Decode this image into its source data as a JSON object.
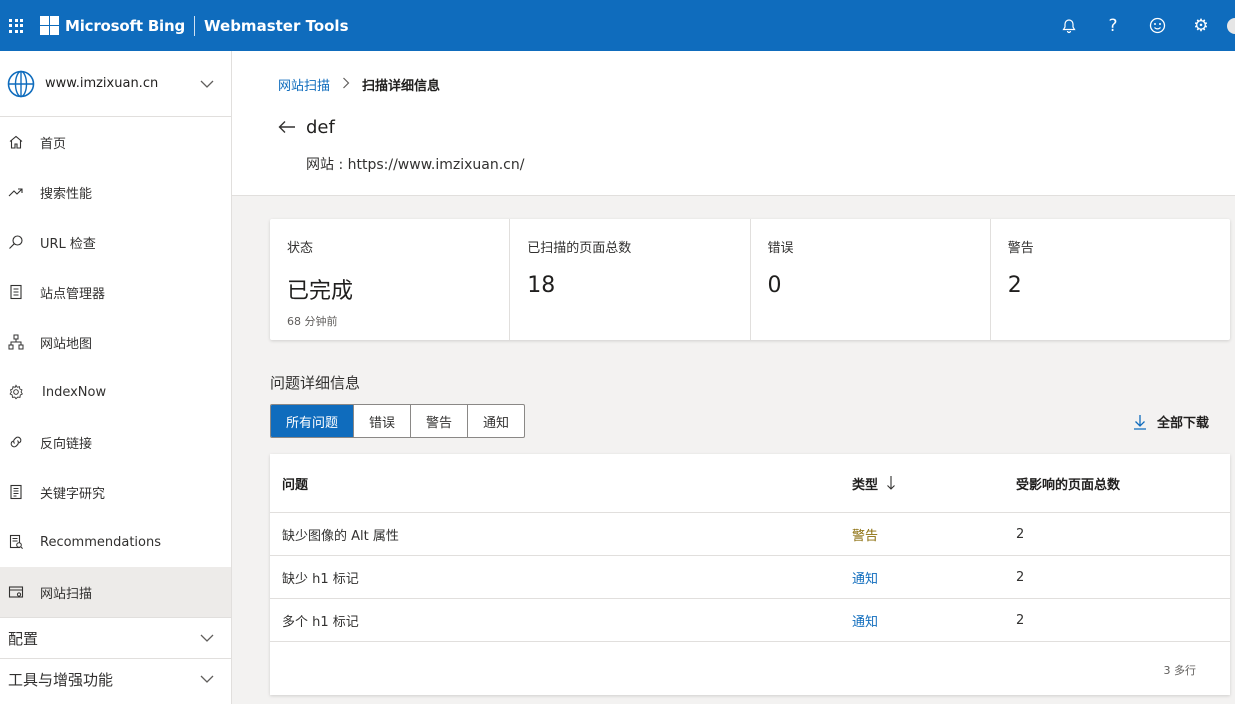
{
  "header": {
    "brand": "Microsoft Bing",
    "product": "Webmaster Tools",
    "icons": [
      "bell-icon",
      "help-icon",
      "feedback-smiley-icon",
      "settings-gear-icon"
    ],
    "accent_color": "#0f6cbd"
  },
  "sidebar": {
    "site": "www.imzixuan.cn",
    "items": [
      {
        "label": "首页",
        "icon": "home-icon"
      },
      {
        "label": "搜索性能",
        "icon": "trend-icon"
      },
      {
        "label": "URL 检查",
        "icon": "search-icon"
      },
      {
        "label": "站点管理器",
        "icon": "clipboard-icon"
      },
      {
        "label": "网站地图",
        "icon": "sitemap-icon"
      },
      {
        "label": "IndexNow",
        "icon": "gear-icon"
      },
      {
        "label": "反向链接",
        "icon": "link-icon"
      },
      {
        "label": "关键字研究",
        "icon": "document-icon"
      },
      {
        "label": "Recommendations",
        "icon": "recommendations-icon"
      },
      {
        "label": "网站扫描",
        "icon": "scan-icon",
        "active": true
      }
    ],
    "groups": [
      {
        "label": "配置"
      },
      {
        "label": "工具与增强功能"
      }
    ]
  },
  "breadcrumb": {
    "parent": "网站扫描",
    "current": "扫描详细信息"
  },
  "scan": {
    "name": "def",
    "site_line": "网站 : https://www.imzixuan.cn/"
  },
  "stats": [
    {
      "label": "状态",
      "value": "已完成",
      "sub": "68 分钟前"
    },
    {
      "label": "已扫描的页面总数",
      "value": "18"
    },
    {
      "label": "错误",
      "value": "0"
    },
    {
      "label": "警告",
      "value": "2"
    }
  ],
  "issues": {
    "title": "问题详细信息",
    "filters": [
      "所有问题",
      "错误",
      "警告",
      "通知"
    ],
    "active_filter": "所有问题",
    "download_label": "全部下载",
    "columns": [
      "问题",
      "类型",
      "受影响的页面总数"
    ],
    "rows": [
      {
        "issue": "缺少图像的 Alt 属性",
        "type": "警告",
        "pages": "2"
      },
      {
        "issue": "缺少 h1 标记",
        "type": "通知",
        "pages": "2"
      },
      {
        "issue": "多个 h1 标记",
        "type": "通知",
        "pages": "2"
      }
    ],
    "footer": "3 多行"
  }
}
